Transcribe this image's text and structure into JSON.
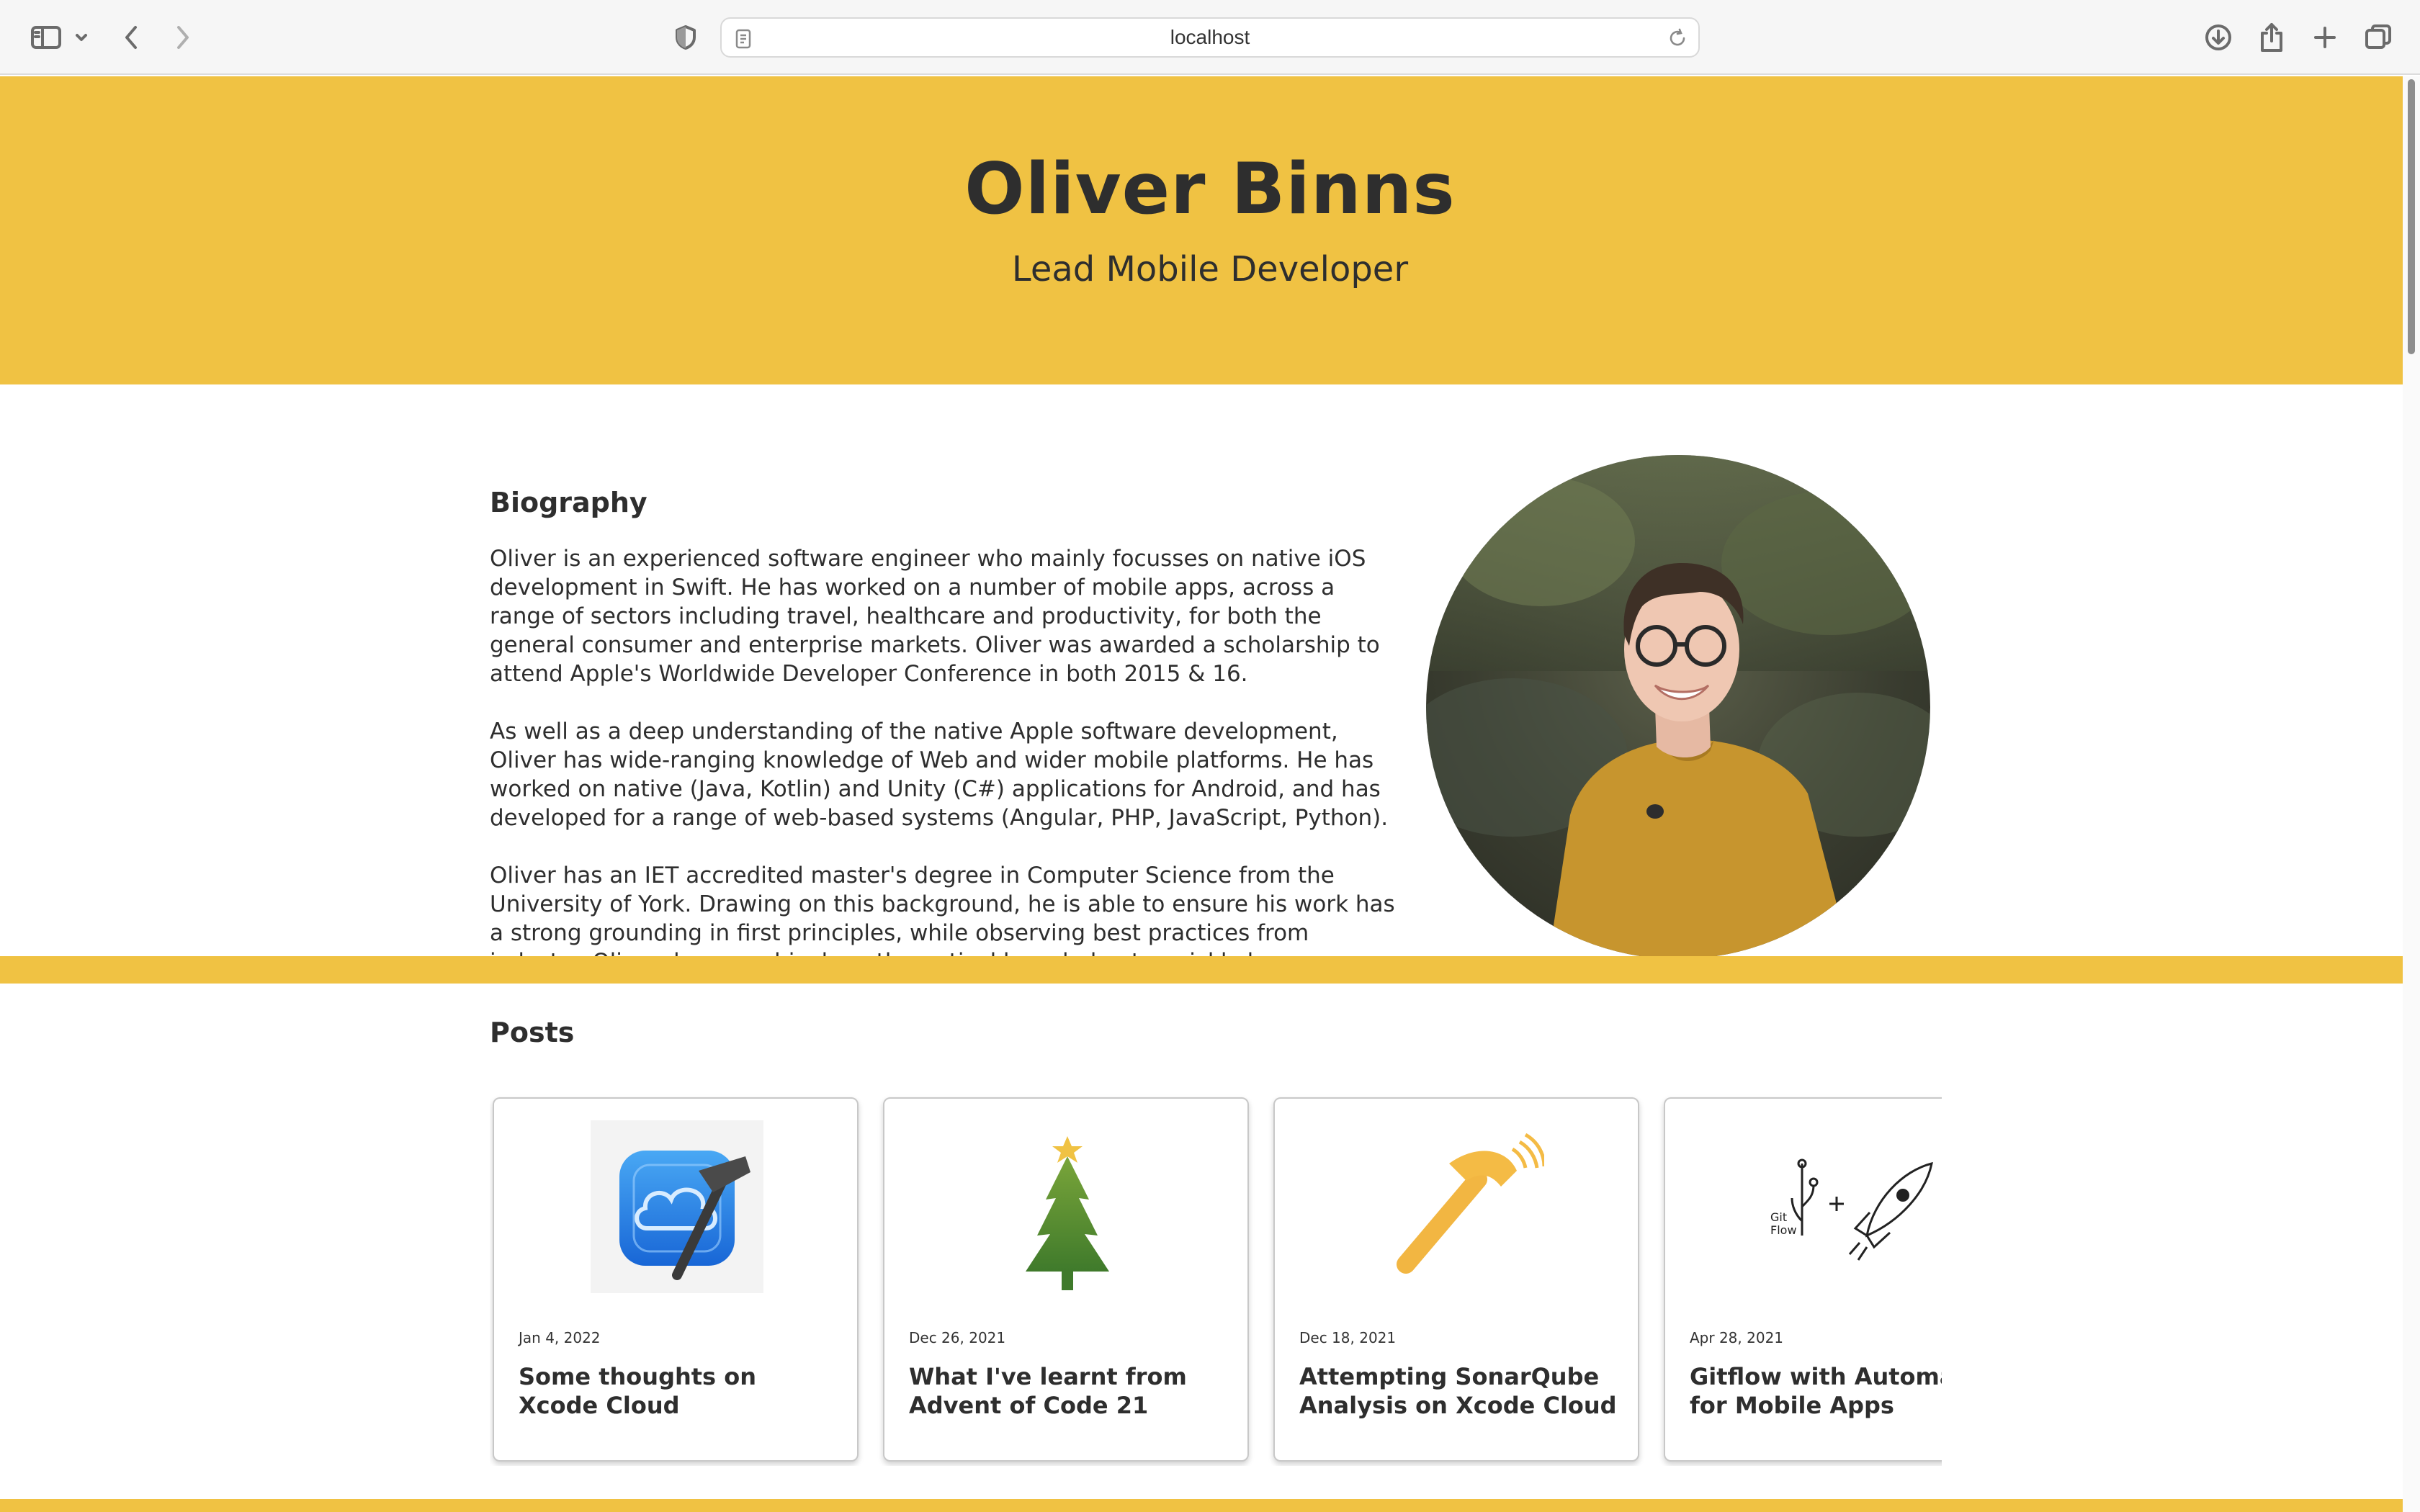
{
  "browser": {
    "url": "localhost",
    "icons": [
      "sidebar-icon",
      "chevron-down-icon",
      "back-icon",
      "forward-icon",
      "shield-icon",
      "page-icon",
      "reload-icon",
      "download-icon",
      "share-icon",
      "new-tab-icon",
      "tabs-overview-icon"
    ]
  },
  "header": {
    "name": "Oliver Binns",
    "subtitle": "Lead Mobile Developer"
  },
  "biography": {
    "title": "Biography",
    "paragraphs": [
      "Oliver is an experienced software engineer who mainly focusses on native iOS development in Swift. He has worked on a number of mobile apps, across a range of sectors including travel, healthcare and productivity, for both the general consumer and enterprise markets. Oliver was awarded a scholarship to attend Apple's Worldwide Developer Conference in both 2015 & 16.",
      "As well as a deep understanding of the native Apple software development, Oliver has wide-ranging knowledge of Web and wider mobile platforms. He has worked on native (Java, Kotlin) and Unity (C#) applications for Android, and has developed for a range of web-based systems (Angular, PHP, JavaScript, Python).",
      "Oliver has an IET accredited master's degree in Computer Science from the University of York. Drawing on this background, he is able to ensure his work has a strong grounding in first principles, while observing best practices from industry. Oliver draws on his deep theoretical knowledge to quickly learn new tools and frameworks."
    ]
  },
  "posts": {
    "title": "Posts",
    "items": [
      {
        "date": "Jan 4, 2022",
        "title": "Some thoughts on Xcode Cloud",
        "icon": "xcode-cloud-icon"
      },
      {
        "date": "Dec 26, 2021",
        "title": "What I've learnt from Advent of Code 21",
        "icon": "christmas-tree-icon"
      },
      {
        "date": "Dec 18, 2021",
        "title": "Attempting SonarQube Analysis on Xcode Cloud",
        "icon": "hammer-icon"
      },
      {
        "date": "Apr 28, 2021",
        "title": "Gitflow with Automation for Mobile Apps",
        "icon": "gitflow-rocket-icon",
        "thumb_text": "Git Flow"
      }
    ]
  },
  "colors": {
    "accent": "#f0c243",
    "text": "#2e2e2e"
  }
}
